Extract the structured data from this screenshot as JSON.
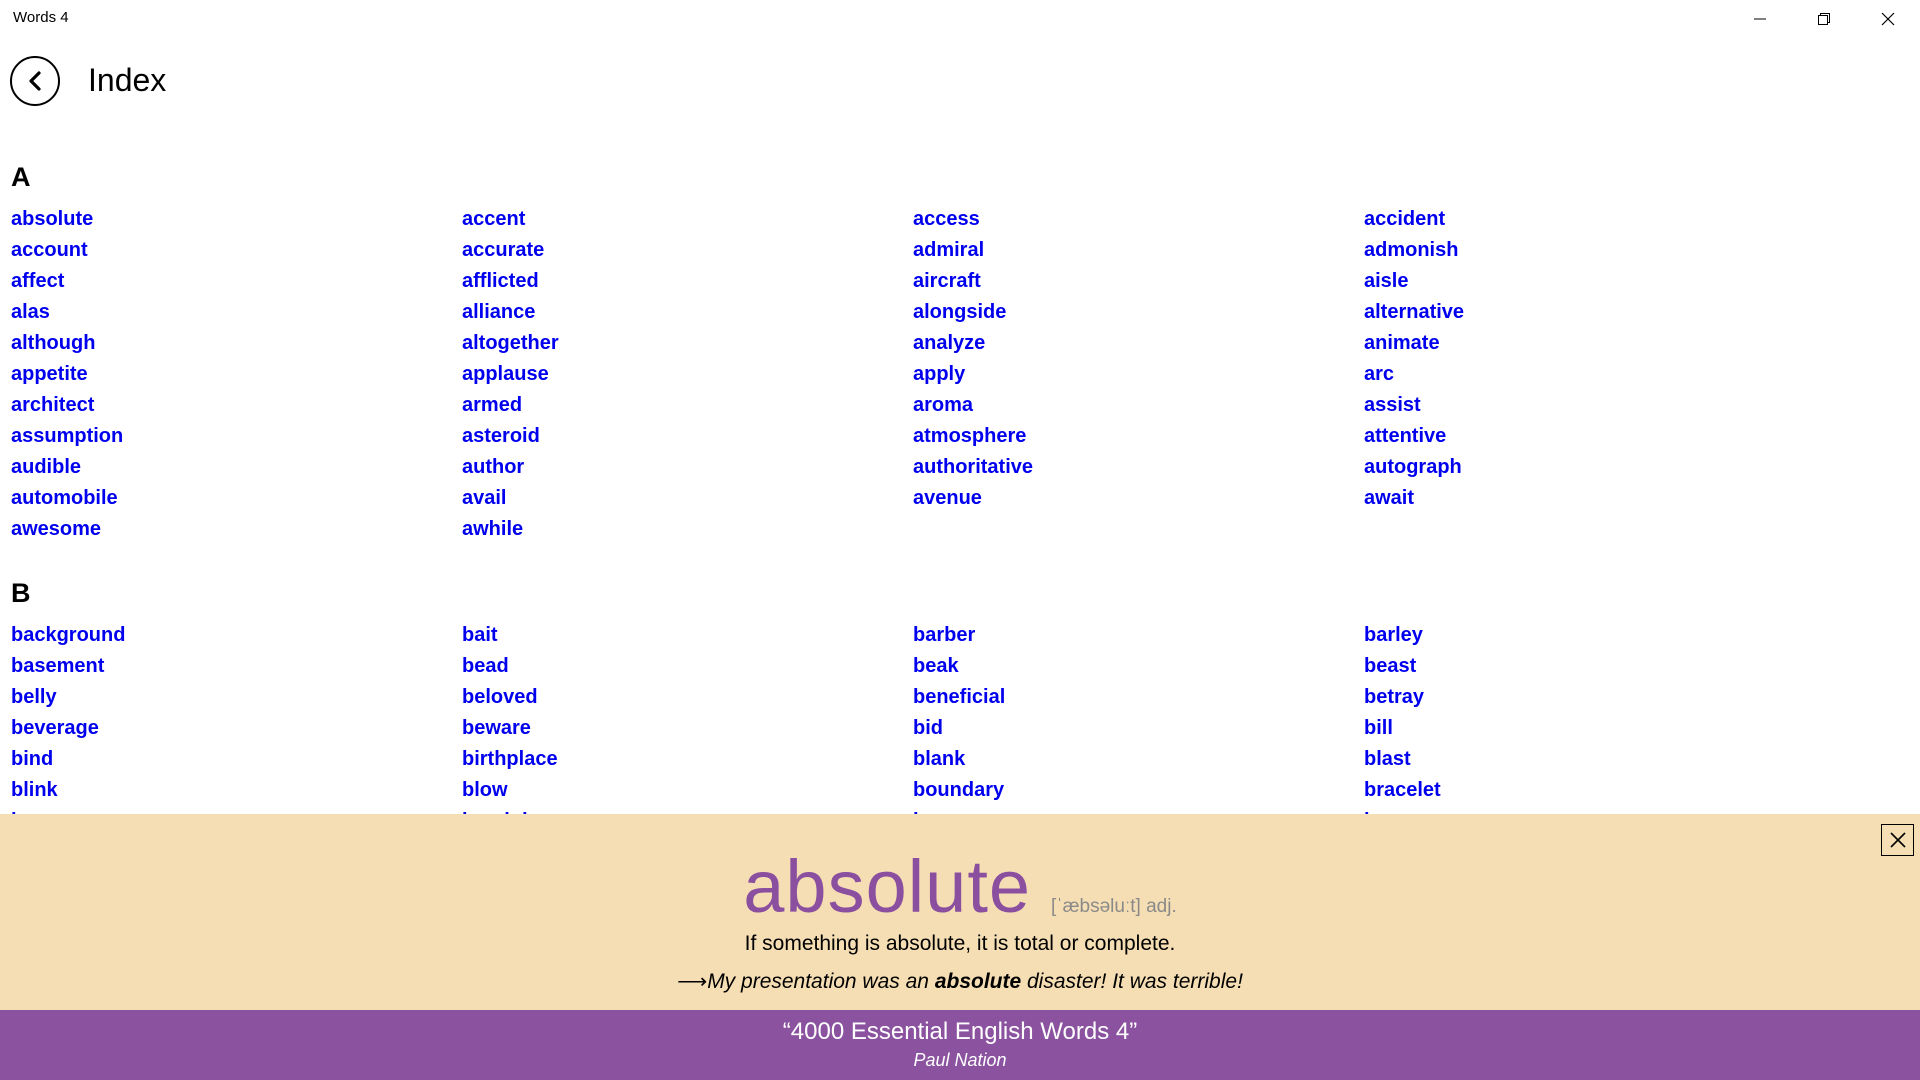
{
  "window": {
    "title": "Words 4"
  },
  "header": {
    "title": "Index"
  },
  "index": {
    "section_a": {
      "letter": "A",
      "words": [
        "absolute",
        "accent",
        "access",
        "accident",
        "account",
        "accurate",
        "admiral",
        "admonish",
        "affect",
        "afflicted",
        "aircraft",
        "aisle",
        "alas",
        "alliance",
        "alongside",
        "alternative",
        "although",
        "altogether",
        "analyze",
        "animate",
        "appetite",
        "applause",
        "apply",
        "arc",
        "architect",
        "armed",
        "aroma",
        "assist",
        "assumption",
        "asteroid",
        "atmosphere",
        "attentive",
        "audible",
        "author",
        "authoritative",
        "autograph",
        "automobile",
        "avail",
        "avenue",
        "await",
        "awesome",
        "awhile"
      ]
    },
    "section_b": {
      "letter": "B",
      "words": [
        "background",
        "bait",
        "barber",
        "barley",
        "basement",
        "bead",
        "beak",
        "beast",
        "belly",
        "beloved",
        "beneficial",
        "betray",
        "beverage",
        "beware",
        "bid",
        "bill",
        "bind",
        "birthplace",
        "blank",
        "blast",
        "blink",
        "blow",
        "boundary",
        "bracelet",
        "brag",
        "breakdown",
        "breeze",
        "brew"
      ]
    }
  },
  "detail": {
    "headword": "absolute",
    "pronunciation": "[ˈæbsəluːt] adj.",
    "definition": "If something is absolute, it is total or complete.",
    "example_arrow": "⟶",
    "example_before": "My presentation was an ",
    "example_bold": "absolute",
    "example_after": " disaster! It was terrible!"
  },
  "footer": {
    "book_title": "“4000 Essential English Words 4”",
    "author": "Paul Nation"
  },
  "colors": {
    "link": "#0000ee",
    "detail_background": "#f5deb3",
    "headword": "#8b4fa0",
    "footer_background": "#8b52a0"
  },
  "icons": {
    "back": "chevron-left-icon",
    "minimize": "minimize-icon",
    "maximize": "restore-icon",
    "close": "close-icon"
  }
}
